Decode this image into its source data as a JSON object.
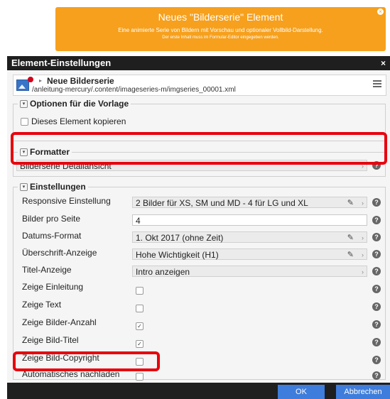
{
  "banner": {
    "title": "Neues \"Bilderserie\" Element",
    "description": "Eine animierte Serie von Bildern mit Vorschau und optionaler Vollbild-Darstellung.",
    "subnote": "Der erste Inhalt muss im Formular-Editor eingegeben werden.",
    "close_icon": "close-circle-icon"
  },
  "dialog": {
    "title": "Element-Einstellungen",
    "close": "×",
    "resource": {
      "name": "Neue Bilderserie",
      "path": "/anleitung-mercury/.content/imageseries-m/imgseries_00001.xml"
    },
    "template_options": {
      "legend": "Optionen für die Vorlage",
      "copy_label": "Dieses Element kopieren"
    },
    "formatter": {
      "legend": "Formatter",
      "value": "Bilderserie Detailansicht'"
    },
    "settings": {
      "legend": "Einstellungen",
      "responsive": {
        "label": "Responsive Einstellung",
        "value": "2 Bilder für XS, SM und MD - 4 für LG und XL"
      },
      "per_page": {
        "label": "Bilder pro Seite",
        "value": "4"
      },
      "date_format": {
        "label": "Datums-Format",
        "value": "1. Okt 2017 (ohne Zeit)"
      },
      "heading": {
        "label": "Überschrift-Anzeige",
        "value": "Hohe Wichtigkeit (H1)"
      },
      "title_display": {
        "label": "Titel-Anzeige",
        "value": "Intro anzeigen"
      },
      "show_intro": {
        "label": "Zeige Einleitung",
        "checked": false
      },
      "show_text": {
        "label": "Zeige Text",
        "checked": false
      },
      "show_count": {
        "label": "Zeige Bilder-Anzahl",
        "checked": true
      },
      "show_img_title": {
        "label": "Zeige Bild-Titel",
        "checked": true
      },
      "show_copyright": {
        "label": "Zeige Bild-Copyright",
        "checked": false
      },
      "auto_reload": {
        "label": "Automatisches nachladen",
        "checked": false
      }
    },
    "buttons": {
      "ok": "OK",
      "cancel": "Abbrechen"
    }
  },
  "glyphs": {
    "arrow": "›",
    "pencil": "✎",
    "help": "?",
    "check": "✓",
    "toggle": "▾",
    "res_arrow": "▸"
  },
  "colors": {
    "banner": "#f6a01d",
    "header": "#1f1f1f",
    "button": "#3e7ddb",
    "highlight": "#e8000d"
  }
}
